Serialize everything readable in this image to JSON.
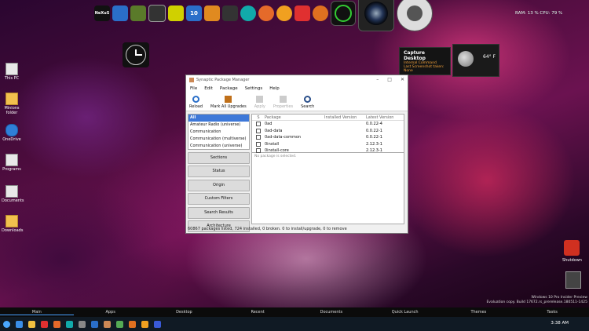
{
  "top_dock": {
    "nexus_label": "NeXuS",
    "badge_10": "10",
    "stats": "RAM: 13 %  CPU: 79 %"
  },
  "desktop_icons": [
    {
      "label": "This PC"
    },
    {
      "label": "Minions folder"
    },
    {
      "label": "OneDrive"
    },
    {
      "label": "Programs"
    },
    {
      "label": "Documents"
    },
    {
      "label": "Downloads"
    }
  ],
  "capture_widget": {
    "title": "Capture Desktop",
    "line1": "Internal Command",
    "line2": "Last Screenshot taken:",
    "line3": "None"
  },
  "weather": {
    "temp": "64° F"
  },
  "window": {
    "title": "Synaptic Package Manager",
    "menu": [
      "File",
      "Edit",
      "Package",
      "Settings",
      "Help"
    ],
    "toolbar": {
      "reload": "Reload",
      "mark_all": "Mark All Upgrades",
      "apply": "Apply",
      "properties": "Properties",
      "search": "Search"
    },
    "sections_list": [
      "All",
      "Amateur Radio (universe)",
      "Communication",
      "Communication (multiverse)",
      "Communication (universe)"
    ],
    "filter_buttons": {
      "sections": "Sections",
      "status": "Status",
      "origin": "Origin",
      "custom": "Custom Filters",
      "search_results": "Search Results",
      "architecture": "Architecture"
    },
    "table_headers": {
      "s": "S",
      "package": "Package",
      "installed": "Installed Version",
      "latest": "Latest Version"
    },
    "packages": [
      {
        "name": "0ad",
        "installed": "",
        "latest": "0.0.22-4"
      },
      {
        "name": "0ad-data",
        "installed": "",
        "latest": "0.0.22-1"
      },
      {
        "name": "0ad-data-common",
        "installed": "",
        "latest": "0.0.22-1"
      },
      {
        "name": "0install",
        "installed": "",
        "latest": "2.12.3-1"
      },
      {
        "name": "0install-core",
        "installed": "",
        "latest": "2.12.3-1"
      }
    ],
    "description": "No package is selected.",
    "status": "60867 packages listed, 724 installed, 0 broken. 0 to install/upgrade, 0 to remove"
  },
  "shutdown_label": "Shutdown",
  "watermark": {
    "line1": "Windows 10 Pro Insider Preview",
    "line2": "Evaluation copy. Build 17672.rs_prerelease.180511-1425"
  },
  "bottom_dock": [
    "Main",
    "Apps",
    "Desktop",
    "Recent",
    "Documents",
    "Quick Launch",
    "Themes",
    "Tasks"
  ],
  "taskbar": {
    "time": "3:38 AM"
  },
  "colors": {
    "accent": "#3d78d8",
    "shutdown": "#d03020"
  }
}
